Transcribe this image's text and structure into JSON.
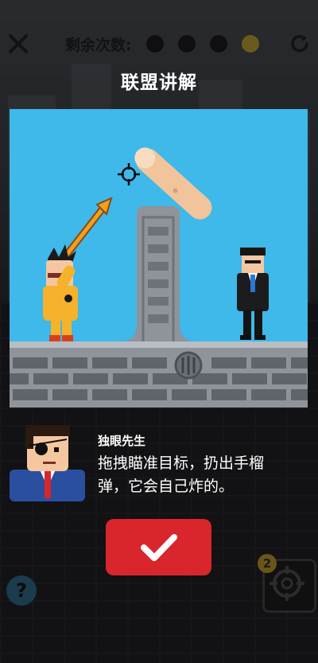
{
  "hud": {
    "shots_label": "剩余次数:",
    "shots_total": 4,
    "shots_remaining": 3
  },
  "title": "联盟讲解",
  "dialog": {
    "speaker": "独眼先生",
    "line1": "拖拽瞄准目标，扔出手榴",
    "line2": "弹，它会自己炸的。"
  },
  "aim_badge": "2",
  "help_label": "?",
  "icons": {
    "close": "close-icon",
    "restart": "restart-icon",
    "confirm": "checkmark-icon",
    "aim": "crosshair-icon"
  },
  "colors": {
    "sky": "#3fb8ea",
    "wall": "#9aa0a6",
    "confirm": "#d8262c",
    "hero": "#f5b22a",
    "arrow": "#f0a020"
  }
}
